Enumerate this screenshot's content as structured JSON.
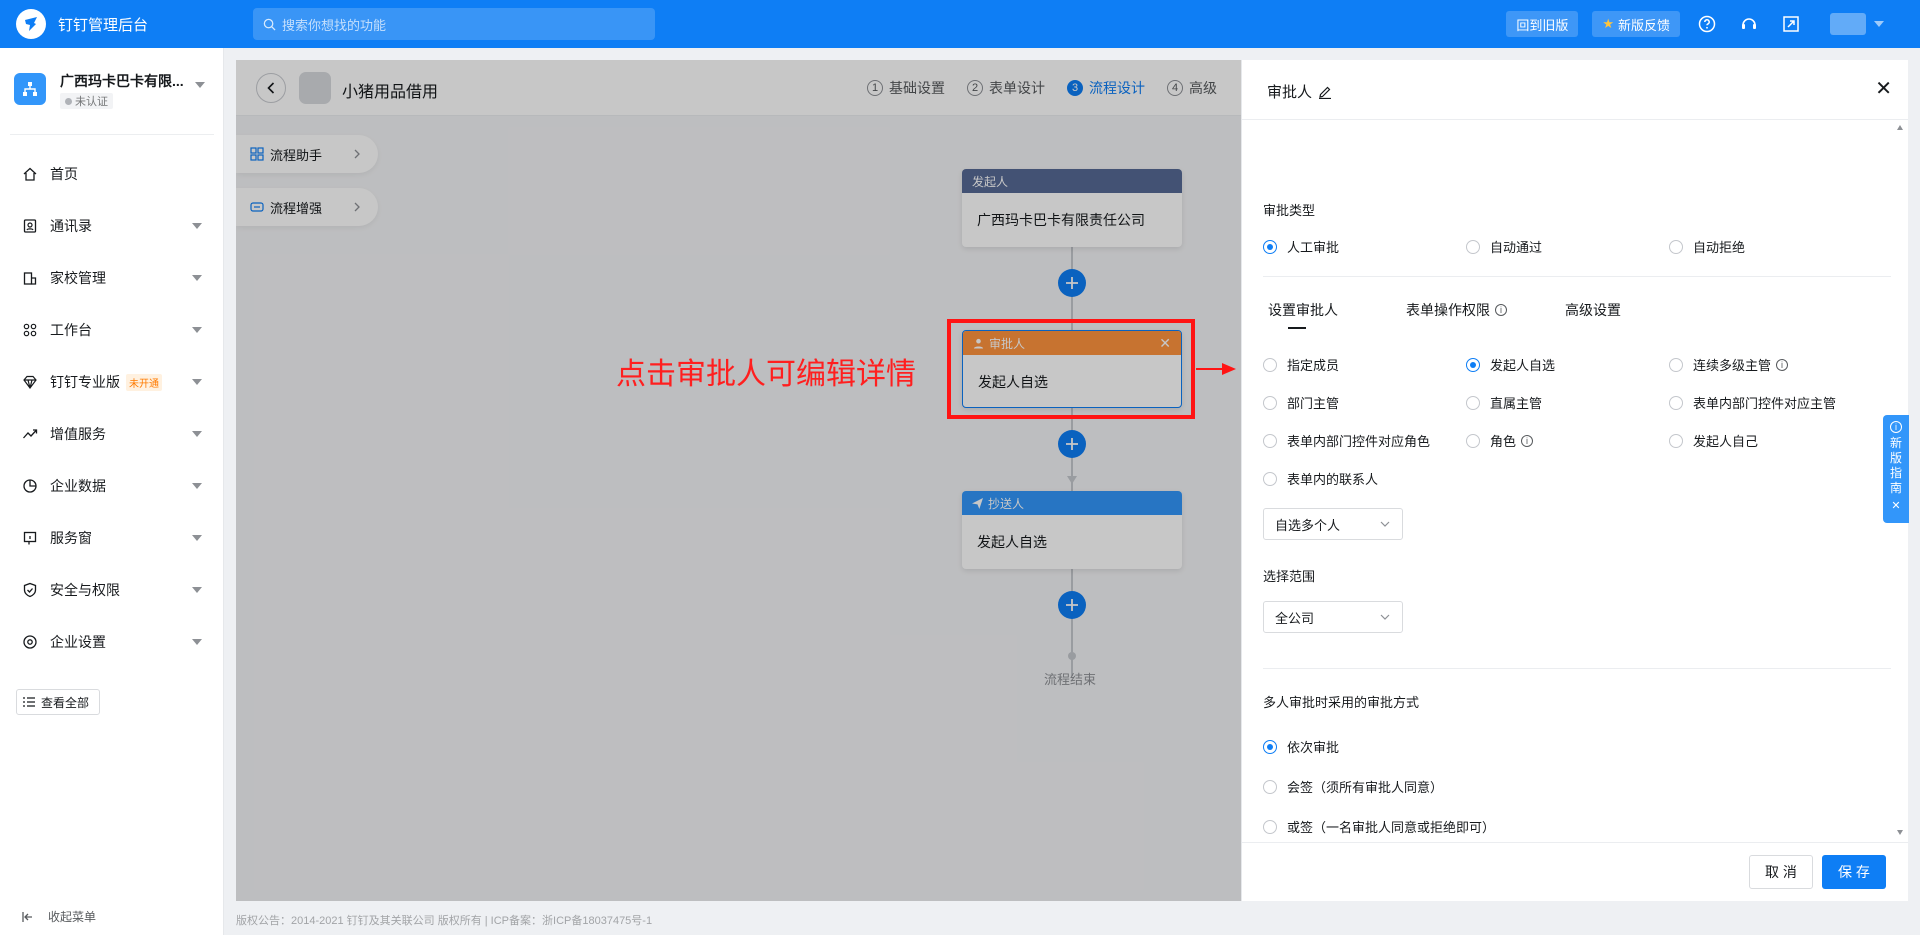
{
  "topbar": {
    "app_title": "钉钉管理后台",
    "search_placeholder": "搜索你想找的功能",
    "old_version_label": "回到旧版",
    "feedback_label": "新版反馈",
    "brand_color": "#0e7ef5"
  },
  "sidebar": {
    "org_name": "广西玛卡巴卡有限...",
    "org_status": "未认证",
    "items": [
      {
        "label": "首页",
        "icon": "home-icon"
      },
      {
        "label": "通讯录",
        "icon": "contacts-icon"
      },
      {
        "label": "家校管理",
        "icon": "school-icon"
      },
      {
        "label": "工作台",
        "icon": "grid-icon"
      },
      {
        "label": "钉钉专业版",
        "icon": "diamond-icon",
        "tag": "未开通"
      },
      {
        "label": "增值服务",
        "icon": "trend-icon"
      },
      {
        "label": "企业数据",
        "icon": "pie-icon"
      },
      {
        "label": "服务窗",
        "icon": "service-icon"
      },
      {
        "label": "安全与权限",
        "icon": "shield-icon"
      },
      {
        "label": "企业设置",
        "icon": "settings-icon"
      }
    ],
    "view_all": "查看全部",
    "collapse": "收起菜单"
  },
  "header": {
    "process_name": "小猪用品借用",
    "steps": [
      {
        "num": "1",
        "label": "基础设置"
      },
      {
        "num": "2",
        "label": "表单设计"
      },
      {
        "num": "3",
        "label": "流程设计"
      },
      {
        "num": "4",
        "label": "高级"
      }
    ]
  },
  "canvas": {
    "assistant": "流程助手",
    "enhance": "流程增强",
    "initiator_title": "发起人",
    "initiator_value": "广西玛卡巴卡有限责任公司",
    "approver_title": "审批人",
    "approver_value": "发起人自选",
    "cc_title": "抄送人",
    "cc_value": "发起人自选",
    "end_label": "流程结束"
  },
  "annotation": {
    "callout": "点击审批人可编辑详情"
  },
  "footer": {
    "text": "版权公告：2014-2021 钉钉及其关联公司 版权所有 | ICP备案：浙ICP备18037475号-1"
  },
  "drawer": {
    "title": "审批人",
    "approval_type_label": "审批类型",
    "approval_types": [
      "人工审批",
      "自动通过",
      "自动拒绝"
    ],
    "tabs": [
      "设置审批人",
      "表单操作权限",
      "高级设置"
    ],
    "approver_options": [
      "指定成员",
      "发起人自选",
      "连续多级主管",
      "部门主管",
      "直属主管",
      "表单内部门控件对应主管",
      "表单内部门控件对应角色",
      "角色",
      "发起人自己",
      "表单内的联系人"
    ],
    "select_mode": "自选多个人",
    "scope_label": "选择范围",
    "scope_value": "全公司",
    "multi_label": "多人审批时采用的审批方式",
    "multi_options": [
      "依次审批",
      "会签（须所有审批人同意）",
      "或签（一名审批人同意或拒绝即可）"
    ],
    "cancel": "取 消",
    "save": "保 存"
  },
  "guide": {
    "text": [
      "新",
      "版",
      "指",
      "南"
    ]
  }
}
